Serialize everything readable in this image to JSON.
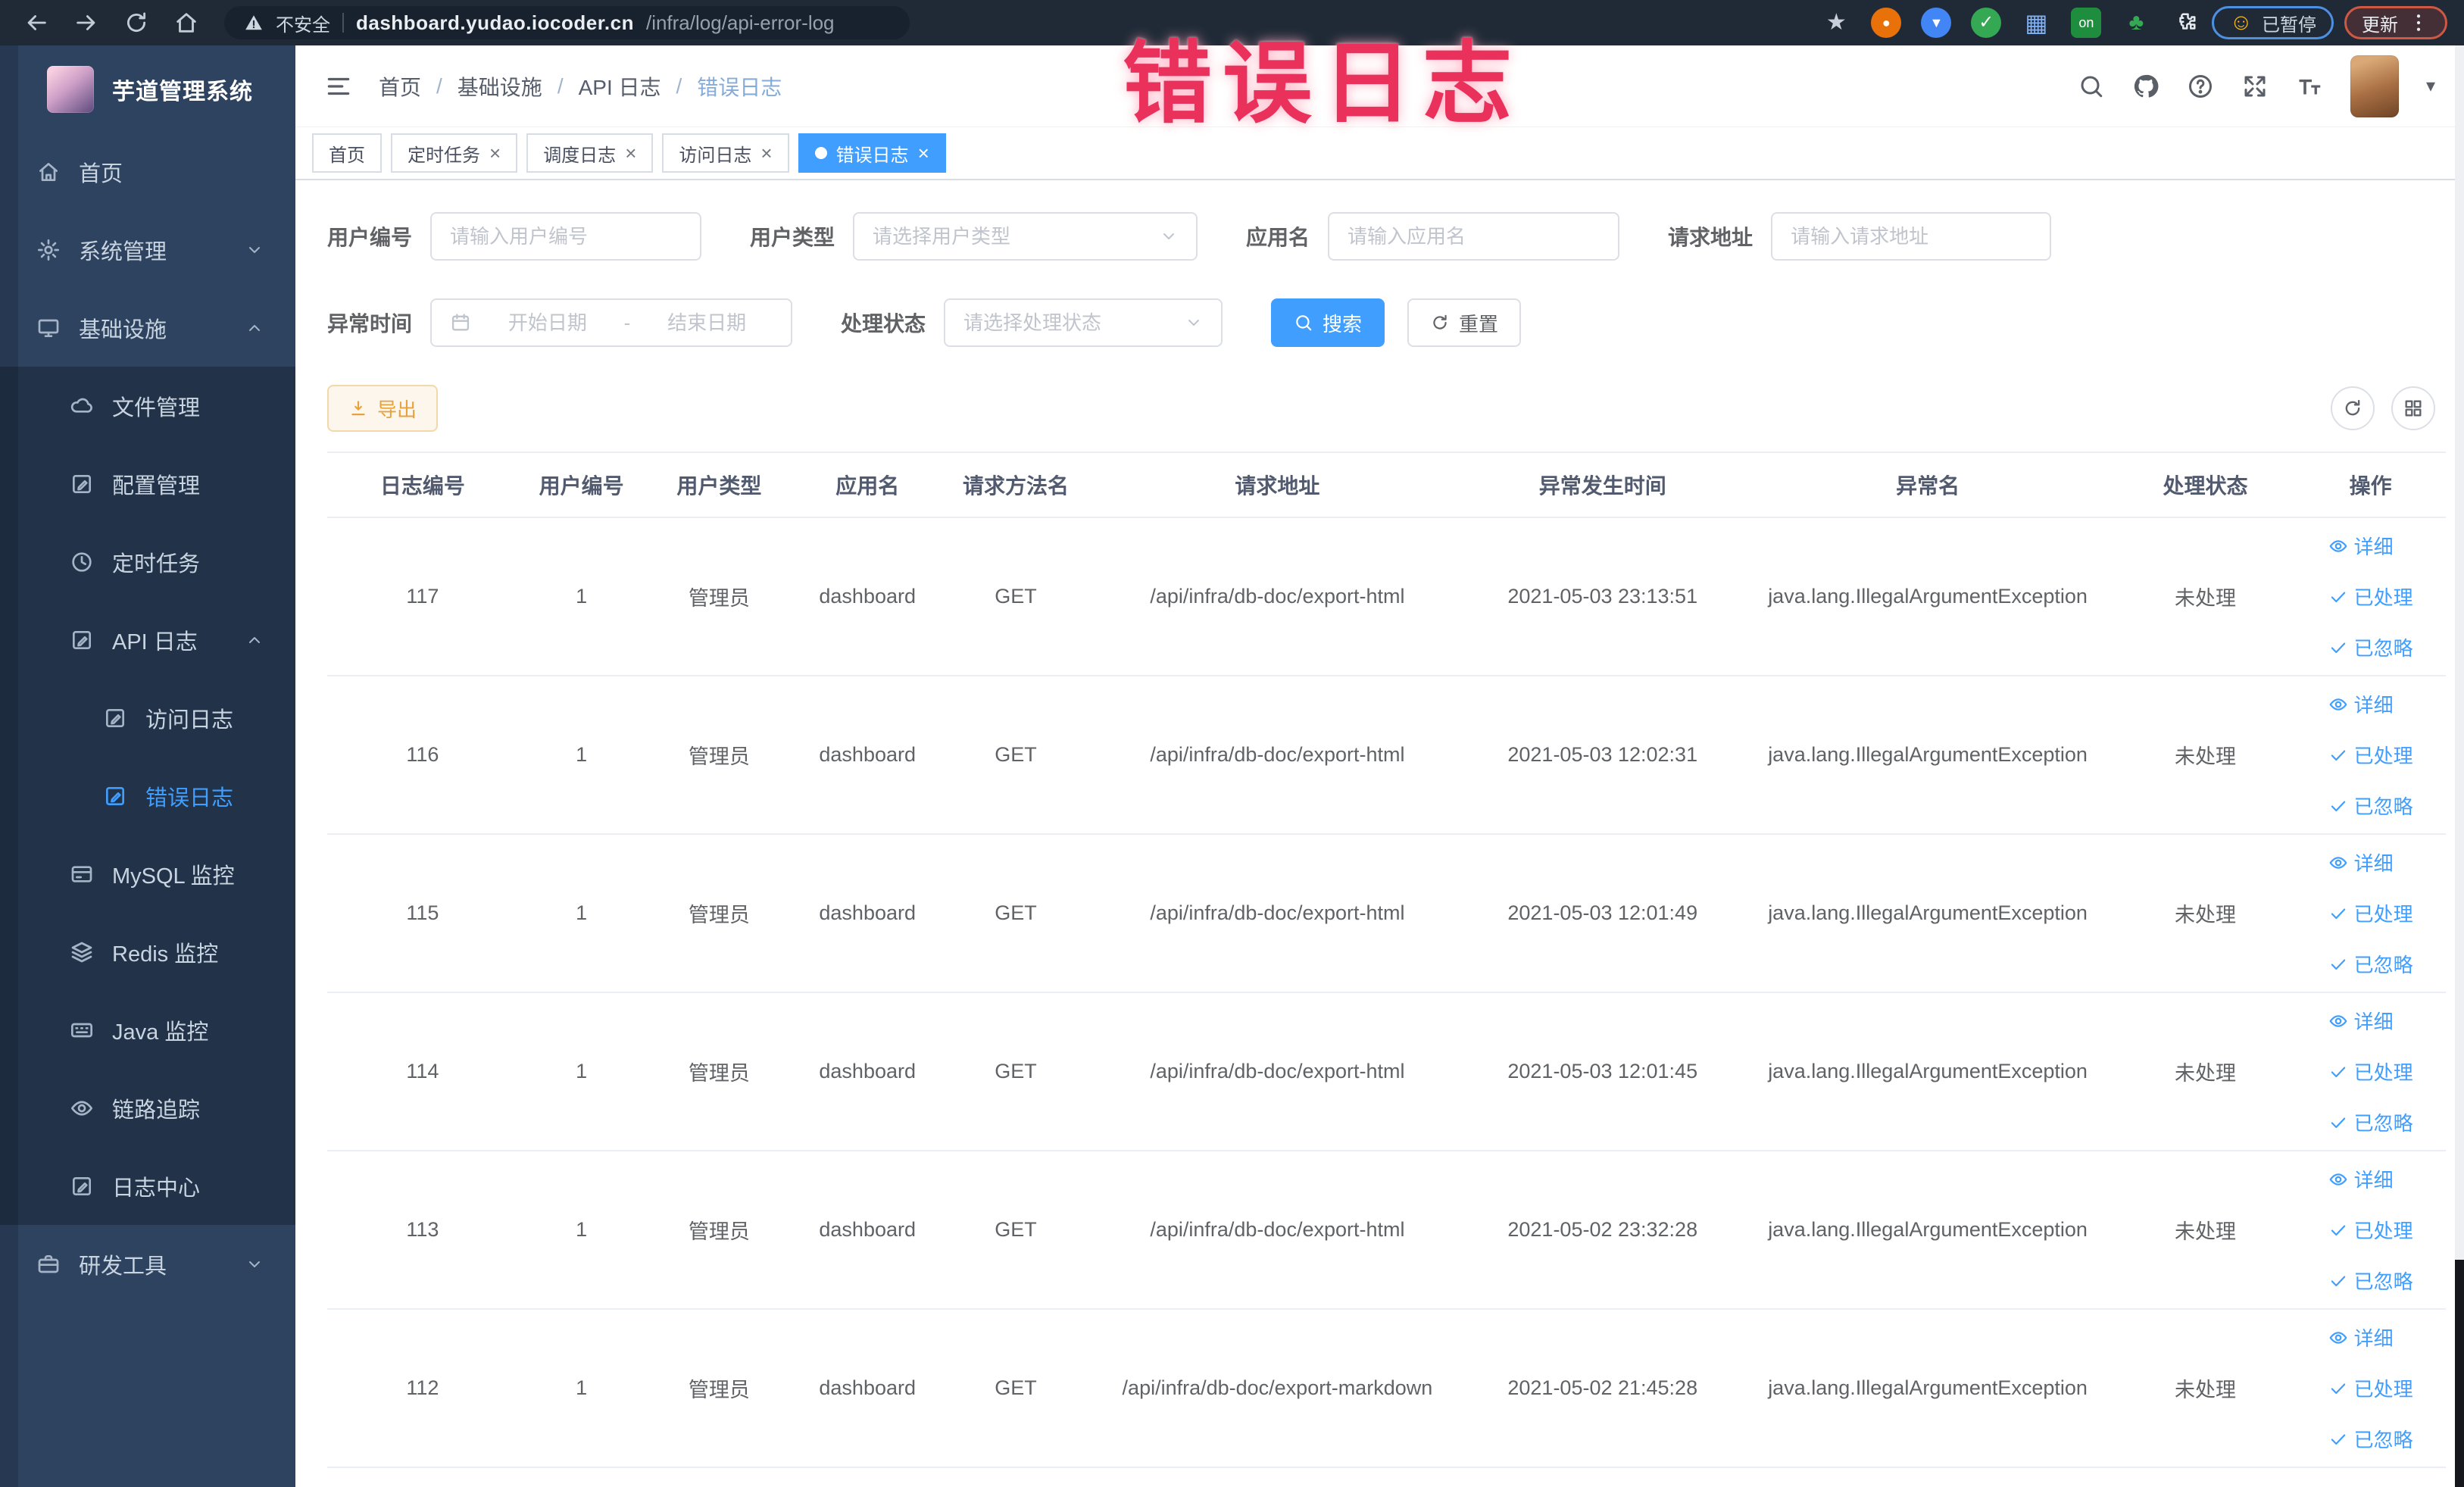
{
  "colors": {
    "accent": "#409eff",
    "warning": "#e6a23c",
    "annotation": "#e9315b",
    "active_tab_bg": "#409eff",
    "menu_bg": "#2e4360",
    "submenu_bg": "#223349"
  },
  "ui": {
    "close_glyph": "×",
    "breadcrumb_separator": "/",
    "date_separator": "-",
    "kebab_glyph": "⋮",
    "caret_glyph": "▾"
  },
  "overlay": {
    "annotation": "错误日志"
  },
  "browser": {
    "security_label": "不安全",
    "url_host": "dashboard.yudao.iocoder.cn",
    "url_path": "/infra/log/api-error-log",
    "paused_badge": "已暂停",
    "paused_emoji": "☺",
    "update_button": "更新",
    "extensions": [
      {
        "name": "bookmark-star-icon",
        "glyph": "★",
        "color": "#c8cfd9",
        "bg": "none",
        "size": 30
      },
      {
        "name": "ext-orange-ring-icon",
        "glyph": "●",
        "color": "#ffffff",
        "bg": "#e8710a",
        "size": 18
      },
      {
        "name": "ext-shield-icon",
        "glyph": "▼",
        "color": "#ffffff",
        "bg": "#4285f4",
        "size": 18
      },
      {
        "name": "ext-green-check-icon",
        "glyph": "✓",
        "color": "#ffffff",
        "bg": "#34a853",
        "size": 24
      },
      {
        "name": "ext-grid-icon",
        "glyph": "▦",
        "color": "#7fb0f5",
        "bg": "none",
        "size": 32
      },
      {
        "name": "ext-on-badge-icon",
        "glyph": "on",
        "color": "#ffffff",
        "bg": "#1e8e3e",
        "size": 18,
        "square": true
      },
      {
        "name": "ext-leaf-icon",
        "glyph": "♣",
        "color": "#34a853",
        "bg": "none",
        "size": 30
      },
      {
        "name": "ext-puzzle-icon",
        "icon": "puzzle-icon",
        "color": "#e6e9ee",
        "bg": "none",
        "size": 30
      }
    ]
  },
  "sidebar": {
    "title": "芋道管理系统",
    "items": [
      {
        "key": "home",
        "label": "首页",
        "icon": "menu-home-icon",
        "level": 0
      },
      {
        "key": "system",
        "label": "系统管理",
        "icon": "gear-icon",
        "level": 0,
        "chevron": "down"
      },
      {
        "key": "infra",
        "label": "基础设施",
        "icon": "monitor-icon",
        "level": 0,
        "chevron": "up"
      },
      {
        "key": "file",
        "label": "文件管理",
        "icon": "cloud-icon",
        "level": 1
      },
      {
        "key": "config",
        "label": "配置管理",
        "icon": "edit-icon",
        "level": 1
      },
      {
        "key": "job",
        "label": "定时任务",
        "icon": "clock-icon",
        "level": 1
      },
      {
        "key": "api-log",
        "label": "API 日志",
        "icon": "edit-icon",
        "level": 1,
        "chevron": "up"
      },
      {
        "key": "access-log",
        "label": "访问日志",
        "icon": "edit-icon",
        "level": 2
      },
      {
        "key": "error-log",
        "label": "错误日志",
        "icon": "edit-icon",
        "level": 2,
        "active": true
      },
      {
        "key": "mysql",
        "label": "MySQL 监控",
        "icon": "card-icon",
        "level": 1
      },
      {
        "key": "redis",
        "label": "Redis 监控",
        "icon": "layers-icon",
        "level": 1
      },
      {
        "key": "java",
        "label": "Java 监控",
        "icon": "keyboard-icon",
        "level": 1
      },
      {
        "key": "trace",
        "label": "链路追踪",
        "icon": "eye-icon",
        "level": 1
      },
      {
        "key": "log-center",
        "label": "日志中心",
        "icon": "edit-icon",
        "level": 1
      },
      {
        "key": "dev-tools",
        "label": "研发工具",
        "icon": "briefcase-icon",
        "level": 0,
        "chevron": "down"
      }
    ]
  },
  "breadcrumb": {
    "items": [
      "首页",
      "基础设施",
      "API 日志",
      "错误日志"
    ]
  },
  "tabs": [
    {
      "key": "home",
      "label": "首页",
      "closable": false,
      "active": false
    },
    {
      "key": "job",
      "label": "定时任务",
      "closable": true,
      "active": false
    },
    {
      "key": "job-log",
      "label": "调度日志",
      "closable": true,
      "active": false
    },
    {
      "key": "access-log",
      "label": "访问日志",
      "closable": true,
      "active": false
    },
    {
      "key": "error-log",
      "label": "错误日志",
      "closable": true,
      "active": true
    }
  ],
  "filters": {
    "user_id_label": "用户编号",
    "user_id_placeholder": "请输入用户编号",
    "user_type_label": "用户类型",
    "user_type_placeholder": "请选择用户类型",
    "app_name_label": "应用名",
    "app_name_placeholder": "请输入应用名",
    "request_url_label": "请求地址",
    "request_url_placeholder": "请输入请求地址",
    "exception_time_label": "异常时间",
    "date_start_placeholder": "开始日期",
    "date_end_placeholder": "结束日期",
    "process_status_label": "处理状态",
    "process_status_placeholder": "请选择处理状态",
    "search_button": "搜索",
    "reset_button": "重置"
  },
  "toolbar": {
    "export_button": "导出"
  },
  "table": {
    "headers": [
      "日志编号",
      "用户编号",
      "用户类型",
      "应用名",
      "请求方法名",
      "请求地址",
      "异常发生时间",
      "异常名",
      "处理状态",
      "操作"
    ],
    "actions": [
      {
        "label": "详细",
        "icon": "eye-icon",
        "name": "action-detail-link"
      },
      {
        "label": "已处理",
        "icon": "check-icon",
        "name": "action-processed-link"
      },
      {
        "label": "已忽略",
        "icon": "check-icon",
        "name": "action-ignored-link"
      }
    ],
    "rows": [
      {
        "id": "117",
        "user_id": "1",
        "user_type": "管理员",
        "app": "dashboard",
        "method": "GET",
        "url": "/api/infra/db-doc/export-html",
        "time": "2021-05-03 23:13:51",
        "exception": "java.lang.IllegalArgumentException",
        "status": "未处理"
      },
      {
        "id": "116",
        "user_id": "1",
        "user_type": "管理员",
        "app": "dashboard",
        "method": "GET",
        "url": "/api/infra/db-doc/export-html",
        "time": "2021-05-03 12:02:31",
        "exception": "java.lang.IllegalArgumentException",
        "status": "未处理"
      },
      {
        "id": "115",
        "user_id": "1",
        "user_type": "管理员",
        "app": "dashboard",
        "method": "GET",
        "url": "/api/infra/db-doc/export-html",
        "time": "2021-05-03 12:01:49",
        "exception": "java.lang.IllegalArgumentException",
        "status": "未处理"
      },
      {
        "id": "114",
        "user_id": "1",
        "user_type": "管理员",
        "app": "dashboard",
        "method": "GET",
        "url": "/api/infra/db-doc/export-html",
        "time": "2021-05-03 12:01:45",
        "exception": "java.lang.IllegalArgumentException",
        "status": "未处理"
      },
      {
        "id": "113",
        "user_id": "1",
        "user_type": "管理员",
        "app": "dashboard",
        "method": "GET",
        "url": "/api/infra/db-doc/export-html",
        "time": "2021-05-02 23:32:28",
        "exception": "java.lang.IllegalArgumentException",
        "status": "未处理"
      },
      {
        "id": "112",
        "user_id": "1",
        "user_type": "管理员",
        "app": "dashboard",
        "method": "GET",
        "url": "/api/infra/db-doc/export-markdown",
        "time": "2021-05-02 21:45:28",
        "exception": "java.lang.IllegalArgumentException",
        "status": "未处理"
      }
    ]
  }
}
